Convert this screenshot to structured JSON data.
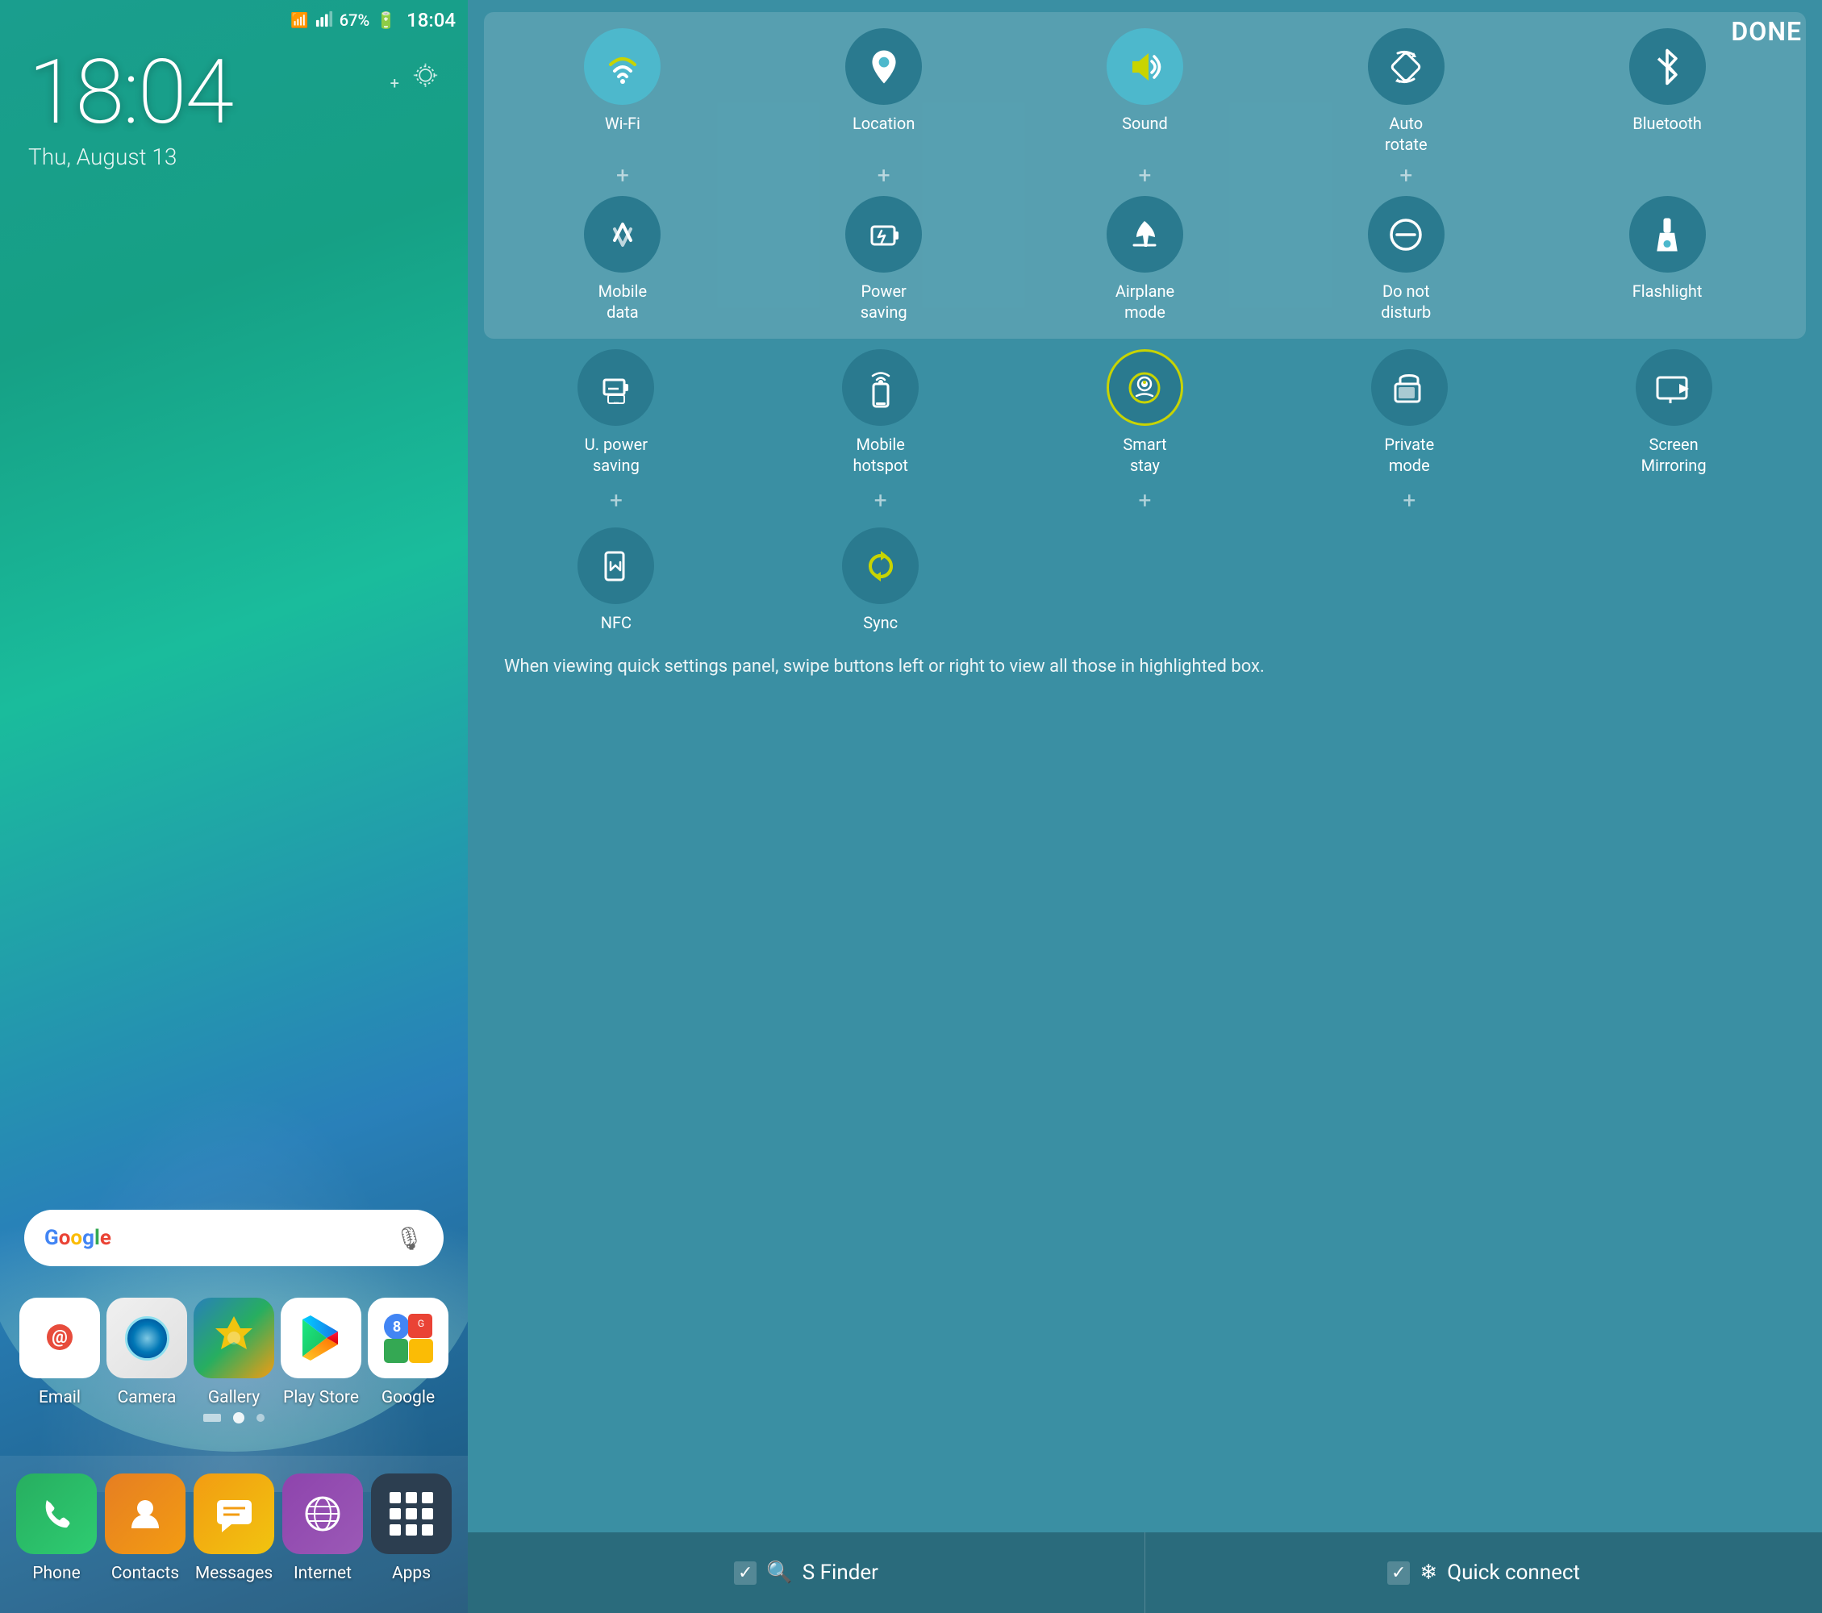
{
  "left": {
    "statusBar": {
      "time": "18:04",
      "battery": "67%"
    },
    "clock": {
      "time": "18:04",
      "date": "Thu, August 13"
    },
    "search": {
      "placeholder": "Google",
      "logo": "Google"
    },
    "apps": [
      {
        "id": "email",
        "label": "Email"
      },
      {
        "id": "camera",
        "label": "Camera"
      },
      {
        "id": "gallery",
        "label": "Gallery"
      },
      {
        "id": "playstore",
        "label": "Play Store"
      },
      {
        "id": "google",
        "label": "Google"
      }
    ],
    "dock": [
      {
        "id": "phone",
        "label": "Phone"
      },
      {
        "id": "contacts",
        "label": "Contacts"
      },
      {
        "id": "messages",
        "label": "Messages"
      },
      {
        "id": "internet",
        "label": "Internet"
      },
      {
        "id": "apps",
        "label": "Apps"
      }
    ]
  },
  "right": {
    "done_label": "DONE",
    "row1": [
      {
        "id": "wifi",
        "label": "Wi-Fi",
        "active": true
      },
      {
        "id": "location",
        "label": "Location",
        "active": false
      },
      {
        "id": "sound",
        "label": "Sound",
        "active": true
      },
      {
        "id": "autorotate",
        "label": "Auto\nrotate",
        "active": false
      },
      {
        "id": "bluetooth",
        "label": "Bluetooth",
        "active": false
      }
    ],
    "row2": [
      {
        "id": "mobiledata",
        "label": "Mobile\ndata",
        "active": false
      },
      {
        "id": "powersaving",
        "label": "Power\nsaving",
        "active": false
      },
      {
        "id": "airplanemode",
        "label": "Airplane\nmode",
        "active": false
      },
      {
        "id": "donotdisturb",
        "label": "Do not\ndisturb",
        "active": false
      },
      {
        "id": "flashlight",
        "label": "Flashlight",
        "active": false
      }
    ],
    "row3": [
      {
        "id": "upowersaving",
        "label": "U. power\nsaving",
        "active": false
      },
      {
        "id": "mobilehotspot",
        "label": "Mobile\nhotspot",
        "active": false
      },
      {
        "id": "smartstay",
        "label": "Smart\nstay",
        "active": true
      },
      {
        "id": "privatemode",
        "label": "Private\nmode",
        "active": false
      },
      {
        "id": "screenmirroring",
        "label": "Screen\nMirroring",
        "active": false
      }
    ],
    "row4": [
      {
        "id": "nfc",
        "label": "NFC",
        "active": false
      },
      {
        "id": "sync",
        "label": "Sync",
        "active": true
      }
    ],
    "infoText": "When viewing quick settings panel, swipe buttons left or right to view all those in highlighted box.",
    "bottom": {
      "sfinder_check": "✓",
      "sfinder_label": "S Finder",
      "quickconnect_check": "✓",
      "quickconnect_label": "Quick connect"
    }
  }
}
